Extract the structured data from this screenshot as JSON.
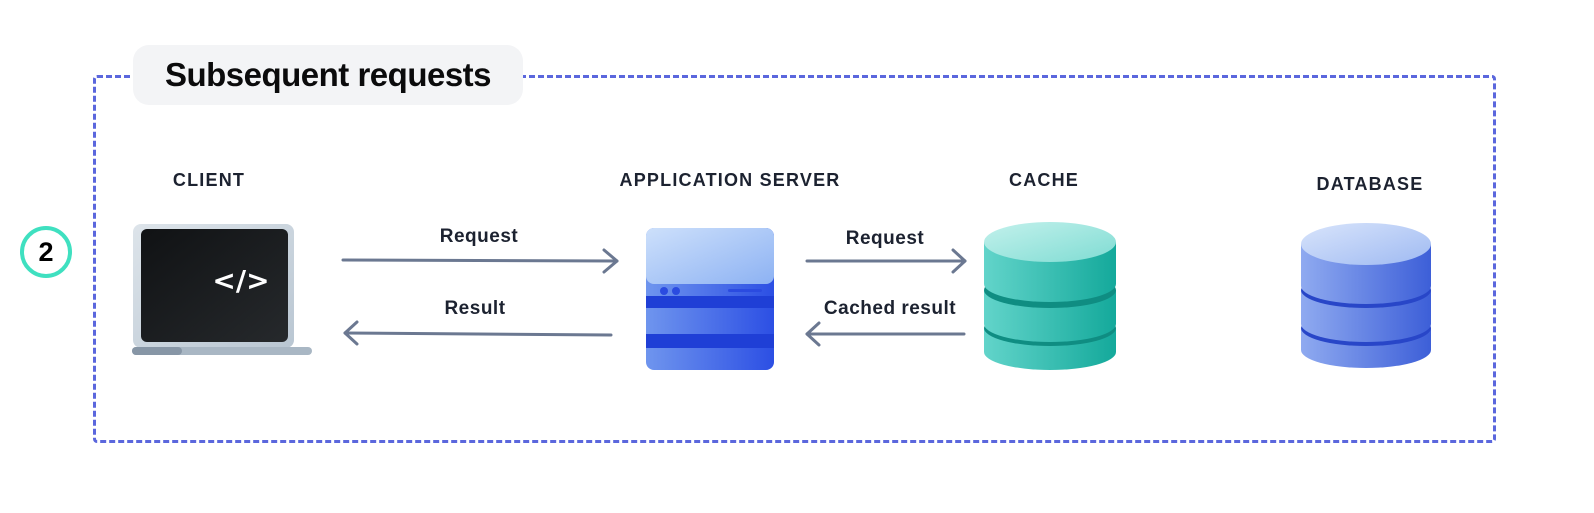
{
  "title": "Subsequent requests",
  "step_number": "2",
  "colors": {
    "frame_border": "#5b67dd",
    "badge_ring": "#3fe0c0",
    "arrow": "#6b7891",
    "cache": "#2ec2b4",
    "database": "#4a6ddf",
    "server": "#3255e8"
  },
  "nodes": {
    "client": {
      "label": "CLIENT",
      "icon": "laptop-code-icon",
      "screen_glyph": "</>"
    },
    "app_server": {
      "label": "APPLICATION SERVER",
      "icon": "server-icon"
    },
    "cache": {
      "label": "CACHE",
      "icon": "cache-database-icon"
    },
    "database": {
      "label": "DATABASE",
      "icon": "database-icon"
    }
  },
  "edges": [
    {
      "from": "client",
      "to": "app_server",
      "label": "Request"
    },
    {
      "from": "app_server",
      "to": "client",
      "label": "Result"
    },
    {
      "from": "app_server",
      "to": "cache",
      "label": "Request"
    },
    {
      "from": "cache",
      "to": "app_server",
      "label": "Cached result"
    }
  ]
}
